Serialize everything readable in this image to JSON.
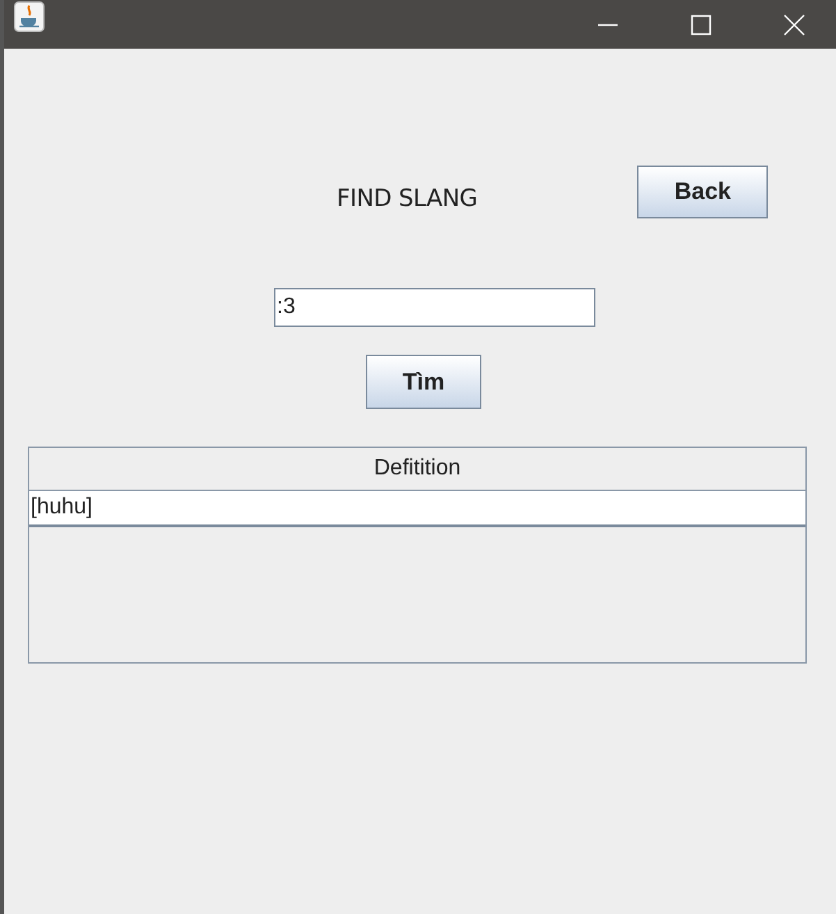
{
  "heading": "FIND SLANG",
  "back_button": "Back",
  "search": {
    "value": ":3"
  },
  "search_button": "Tìm",
  "table": {
    "columns": [
      "Defitition"
    ],
    "rows": [
      [
        "[huhu]"
      ]
    ]
  }
}
